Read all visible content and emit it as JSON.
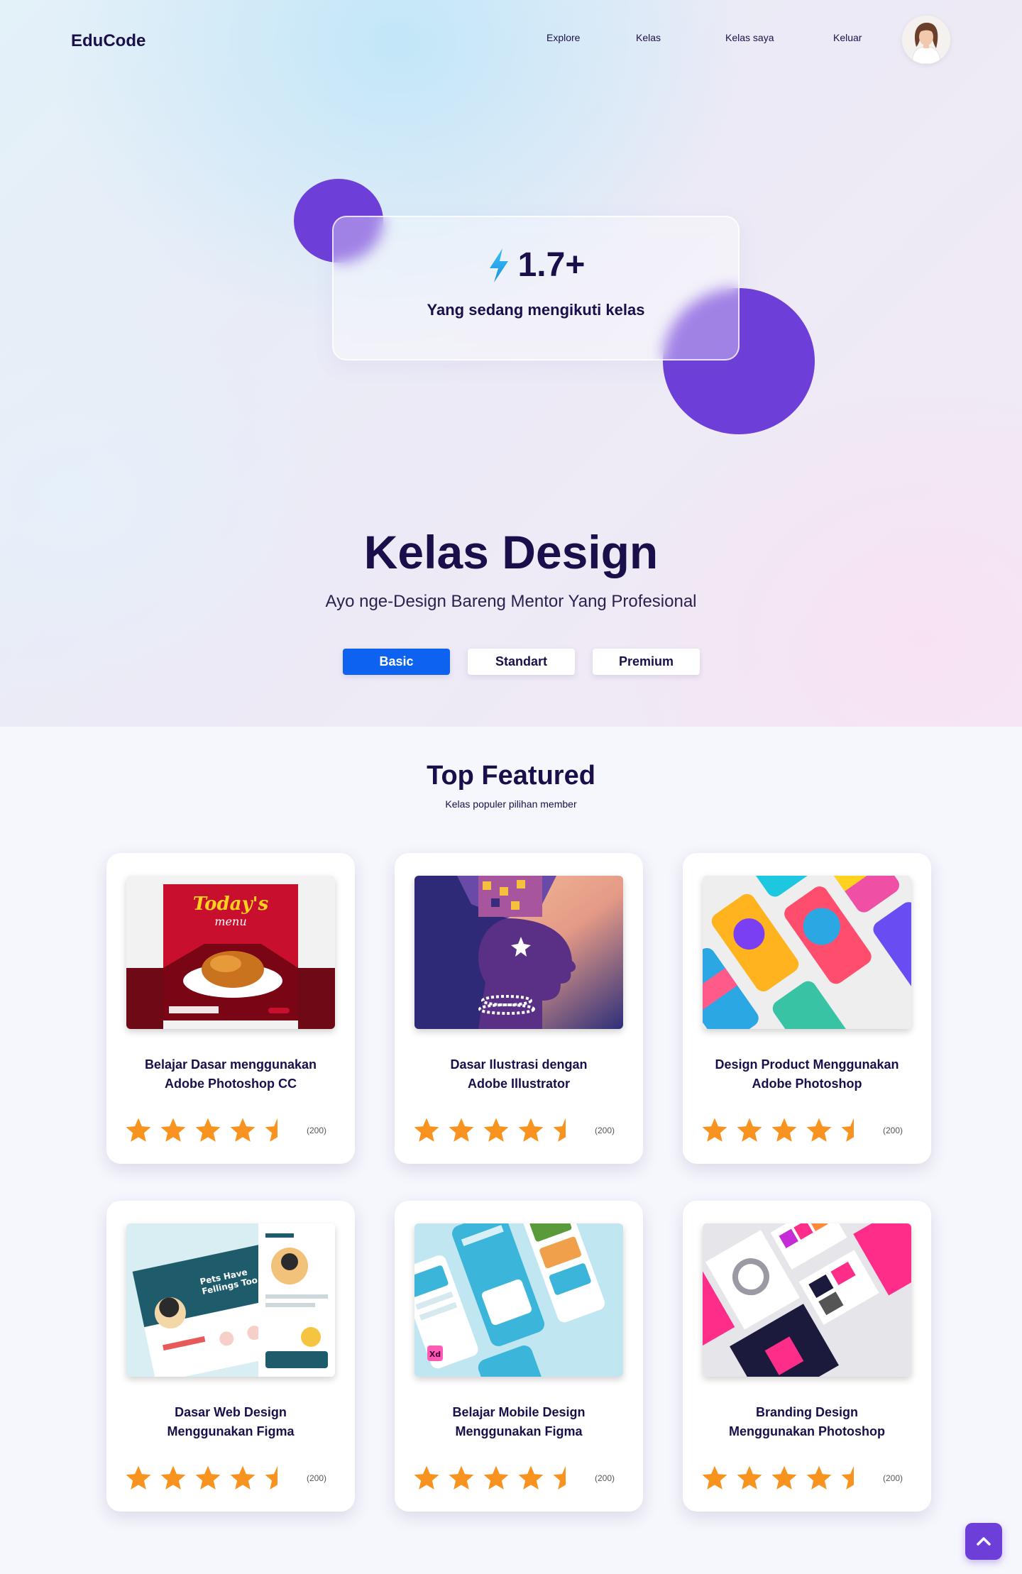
{
  "header": {
    "brand": "EduCode",
    "nav": [
      "Explore",
      "Kelas",
      "Kelas saya",
      "Keluar"
    ]
  },
  "hero": {
    "stat_value": "1.7+",
    "stat_caption": "Yang sedang mengikuti kelas",
    "title": "Kelas Design",
    "subtitle": "Ayo nge-Design Bareng Mentor Yang Profesional",
    "tiers": [
      "Basic",
      "Standart",
      "Premium"
    ],
    "active_tier": "Basic"
  },
  "featured": {
    "title": "Top Featured",
    "subtitle": "Kelas populer pilihan member",
    "courses": [
      {
        "title_line1": "Belajar Dasar menggunakan",
        "title_line2": "Adobe Photoshop CC",
        "rating": 4.5,
        "count": "(200)",
        "thumb": "food-menu-poster"
      },
      {
        "title_line1": "Dasar Ilustrasi dengan",
        "title_line2": "Adobe Illustrator",
        "rating": 4.5,
        "count": "(200)",
        "thumb": "portrait-illustration"
      },
      {
        "title_line1": "Design Product Menggunakan",
        "title_line2": "Adobe Photoshop",
        "rating": 4.5,
        "count": "(200)",
        "thumb": "phone-case-mockup"
      },
      {
        "title_line1": "Dasar Web Design",
        "title_line2": "Menggunakan Figma",
        "rating": 4.5,
        "count": "(200)",
        "thumb": "pet-website-mockup"
      },
      {
        "title_line1": "Belajar Mobile Design",
        "title_line2": "Menggunakan Figma",
        "rating": 4.5,
        "count": "(200)",
        "thumb": "travel-app-mockup"
      },
      {
        "title_line1": "Branding Design",
        "title_line2": "Menggunakan Photoshop",
        "rating": 4.5,
        "count": "(200)",
        "thumb": "branding-mockup"
      }
    ]
  },
  "colors": {
    "accent_purple": "#6e3fd8",
    "primary_blue": "#0d63f0",
    "star_orange": "#f7931e",
    "text_dark": "#1a0f4a"
  },
  "icons": {
    "stat": "lightning-icon",
    "rating": "star-icon",
    "scroll_top": "chevron-up-icon"
  }
}
